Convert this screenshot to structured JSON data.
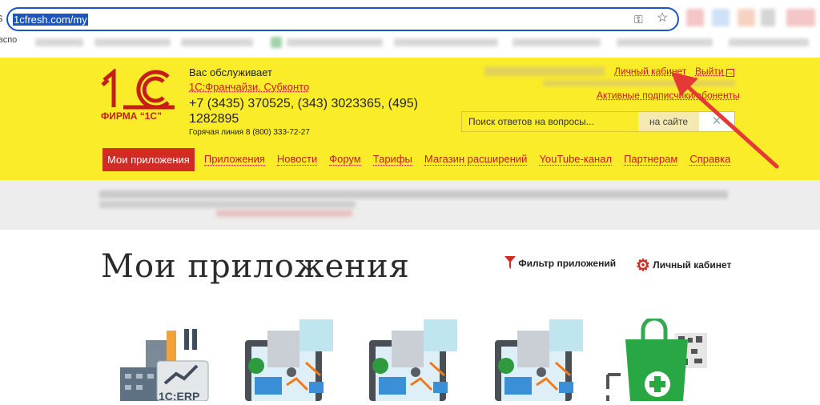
{
  "browser": {
    "url": "1cfresh.com/my",
    "left_fragment": "s",
    "bookmark_fragment": "вспо"
  },
  "header": {
    "logo_label": "ФИРМА “1С”",
    "served_by": "Вас обслуживает",
    "partner": "1С:Франчайзи. Субконто",
    "phones": "+7 (3435) 370525, (343) 3023365, (495) 1282895",
    "hotline": "Горячая линия 8 (800) 333-72-27",
    "account_link": "Личный кабинет",
    "logout_link": "Выйти",
    "subscribers_link": "Активные подписчики/абоненты",
    "search_placeholder": "Поиск ответов на вопросы...",
    "search_scope": "на сайте"
  },
  "nav": {
    "items": [
      "Мои приложения",
      "Приложения",
      "Новости",
      "Форум",
      "Тарифы",
      "Магазин расширений",
      "YouTube-канал",
      "Партнерам",
      "Справка"
    ]
  },
  "main": {
    "title": "Мои приложения",
    "filter_label": "Фильтр приложений",
    "account_label": "Личный кабинет",
    "app1_caption": "1C:ERP"
  },
  "colors": {
    "accent": "#c41e16",
    "header_bg": "#fbec2a",
    "annotation_arrow": "#e53935"
  }
}
